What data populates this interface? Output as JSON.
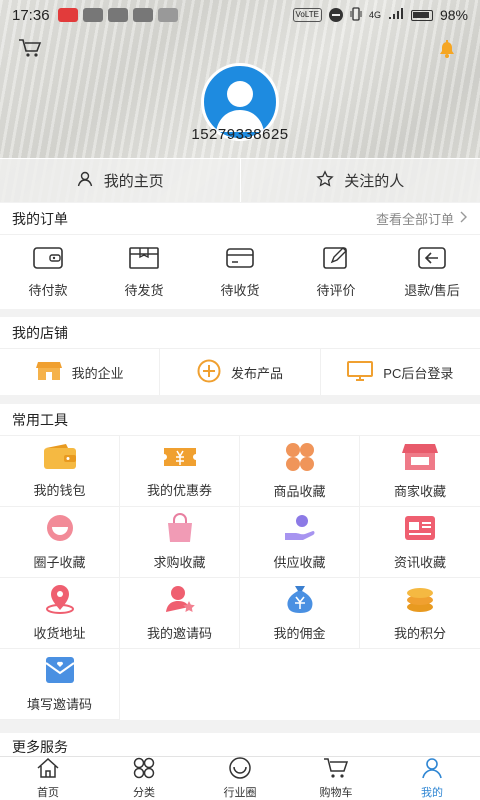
{
  "status_bar": {
    "time": "17:36",
    "network": "4G",
    "volte": "VoLTE",
    "battery": "98%"
  },
  "header": {
    "icons": {
      "cart": "cart-icon",
      "bell": "bell-icon"
    },
    "phone": "15279338625",
    "tabs": [
      {
        "label": "我的主页",
        "icon": "user-icon"
      },
      {
        "label": "关注的人",
        "icon": "star-icon"
      }
    ]
  },
  "orders": {
    "title": "我的订单",
    "view_all": "查看全部订单",
    "items": [
      {
        "label": "待付款",
        "icon": "wallet-icon"
      },
      {
        "label": "待发货",
        "icon": "package-icon"
      },
      {
        "label": "待收货",
        "icon": "card-icon"
      },
      {
        "label": "待评价",
        "icon": "edit-icon"
      },
      {
        "label": "退款/售后",
        "icon": "refund-icon"
      }
    ]
  },
  "shop": {
    "title": "我的店铺",
    "items": [
      {
        "label": "我的企业",
        "icon": "store-icon"
      },
      {
        "label": "发布产品",
        "icon": "plus-circle-icon"
      },
      {
        "label": "PC后台登录",
        "icon": "monitor-icon"
      }
    ]
  },
  "tools": {
    "title": "常用工具",
    "items": [
      {
        "label": "我的钱包",
        "icon": "wallet-icon"
      },
      {
        "label": "我的优惠券",
        "icon": "coupon-icon"
      },
      {
        "label": "商品收藏",
        "icon": "clover-icon"
      },
      {
        "label": "商家收藏",
        "icon": "shop-icon"
      },
      {
        "label": "圈子收藏",
        "icon": "smile-icon"
      },
      {
        "label": "求购收藏",
        "icon": "bag-icon"
      },
      {
        "label": "供应收藏",
        "icon": "hand-icon"
      },
      {
        "label": "资讯收藏",
        "icon": "news-icon"
      },
      {
        "label": "收货地址",
        "icon": "location-icon"
      },
      {
        "label": "我的邀请码",
        "icon": "user-star-icon"
      },
      {
        "label": "我的佣金",
        "icon": "money-bag-icon"
      },
      {
        "label": "我的积分",
        "icon": "coins-icon"
      },
      {
        "label": "填写邀请码",
        "icon": "envelope-icon"
      }
    ]
  },
  "more": {
    "title": "更多服务"
  },
  "bottom_nav": {
    "active": "我的",
    "items": [
      {
        "label": "首页",
        "icon": "home-icon"
      },
      {
        "label": "分类",
        "icon": "category-icon"
      },
      {
        "label": "行业圈",
        "icon": "circle-icon"
      },
      {
        "label": "购物车",
        "icon": "cart-icon"
      },
      {
        "label": "我的",
        "icon": "user-icon"
      }
    ]
  },
  "colors": {
    "accent": "#2f86d3",
    "orange": "#f0a030",
    "pink": "#ef5f70",
    "avatar": "#1e8be0"
  }
}
